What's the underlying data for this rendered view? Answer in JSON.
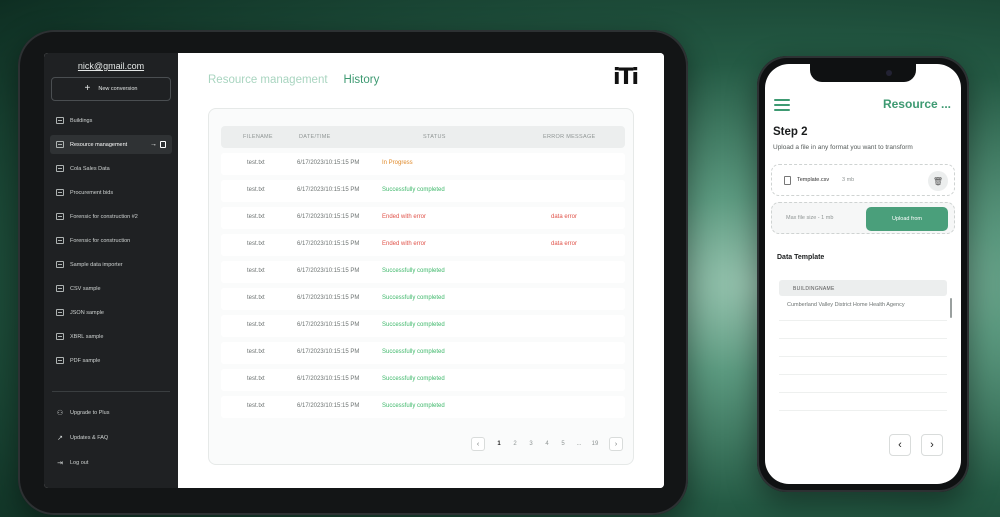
{
  "sidebar": {
    "user_email": "nick@gmail.com",
    "new_conversion": "New conversion",
    "items": [
      {
        "label": "Buildings",
        "active": false
      },
      {
        "label": "Resource management",
        "active": true
      },
      {
        "label": "Cola Sales Data",
        "active": false
      },
      {
        "label": "Procurement bids",
        "active": false
      },
      {
        "label": "Forensic for construction #2",
        "active": false
      },
      {
        "label": "Forensic for construction",
        "active": false
      },
      {
        "label": "Sample data importer",
        "active": false
      },
      {
        "label": "CSV sample",
        "active": false
      },
      {
        "label": "JSON sample",
        "active": false
      },
      {
        "label": "XBRL sample",
        "active": false
      },
      {
        "label": "PDF sample",
        "active": false
      }
    ],
    "bottom": [
      {
        "label": "Upgrade to Plus",
        "icon": "user-plus-icon"
      },
      {
        "label": "Updates & FAQ",
        "icon": "external-link-icon"
      },
      {
        "label": "Log out",
        "icon": "logout-icon"
      }
    ]
  },
  "header": {
    "tabs": [
      {
        "label": "Resource management",
        "active": false
      },
      {
        "label": "History",
        "active": true
      }
    ],
    "logo_text": "iTi"
  },
  "table": {
    "columns": [
      "FILENAME",
      "DATE/TIME",
      "STATUS",
      "ERROR MESSAGE"
    ],
    "rows": [
      {
        "filename": "test.txt",
        "datetime": "6/17/2023/10:15:15 PM",
        "status": "In Progress",
        "status_type": "progress",
        "error": ""
      },
      {
        "filename": "test.txt",
        "datetime": "6/17/2023/10:15:15 PM",
        "status": "Successfully completed",
        "status_type": "ok",
        "error": ""
      },
      {
        "filename": "test.txt",
        "datetime": "6/17/2023/10:15:15 PM",
        "status": "Ended with error",
        "status_type": "err",
        "error": "data error"
      },
      {
        "filename": "test.txt",
        "datetime": "6/17/2023/10:15:15 PM",
        "status": "Ended with error",
        "status_type": "err",
        "error": "data error"
      },
      {
        "filename": "test.txt",
        "datetime": "6/17/2023/10:15:15 PM",
        "status": "Successfully completed",
        "status_type": "ok",
        "error": ""
      },
      {
        "filename": "test.txt",
        "datetime": "6/17/2023/10:15:15 PM",
        "status": "Successfully completed",
        "status_type": "ok",
        "error": ""
      },
      {
        "filename": "test.txt",
        "datetime": "6/17/2023/10:15:15 PM",
        "status": "Successfully completed",
        "status_type": "ok",
        "error": ""
      },
      {
        "filename": "test.txt",
        "datetime": "6/17/2023/10:15:15 PM",
        "status": "Successfully completed",
        "status_type": "ok",
        "error": ""
      },
      {
        "filename": "test.txt",
        "datetime": "6/17/2023/10:15:15 PM",
        "status": "Successfully completed",
        "status_type": "ok",
        "error": ""
      },
      {
        "filename": "test.txt",
        "datetime": "6/17/2023/10:15:15 PM",
        "status": "Successfully completed",
        "status_type": "ok",
        "error": ""
      }
    ]
  },
  "pagination": {
    "prev": "‹",
    "pages": [
      "1",
      "2",
      "3",
      "4",
      "5",
      "...",
      "19"
    ],
    "current": "1",
    "next": "›"
  },
  "phone": {
    "title": "Resource ...",
    "step_title": "Step 2",
    "step_subtitle": "Upload a file in any format you want to transform",
    "file_name": "Template.csv",
    "file_size": "3 mb",
    "max_size": "Max file size - 1 mb",
    "upload_button": "Upload from",
    "data_template_title": "Data Template",
    "table_header": "BUILDINGNAME",
    "table_cell": "Cumberland Valley District Home Health Agency",
    "prev": "‹",
    "next": "›"
  },
  "colors": {
    "accent": "#3e9a72",
    "in_progress": "#e08a2a",
    "success": "#3fb86b",
    "error": "#e0534a"
  }
}
